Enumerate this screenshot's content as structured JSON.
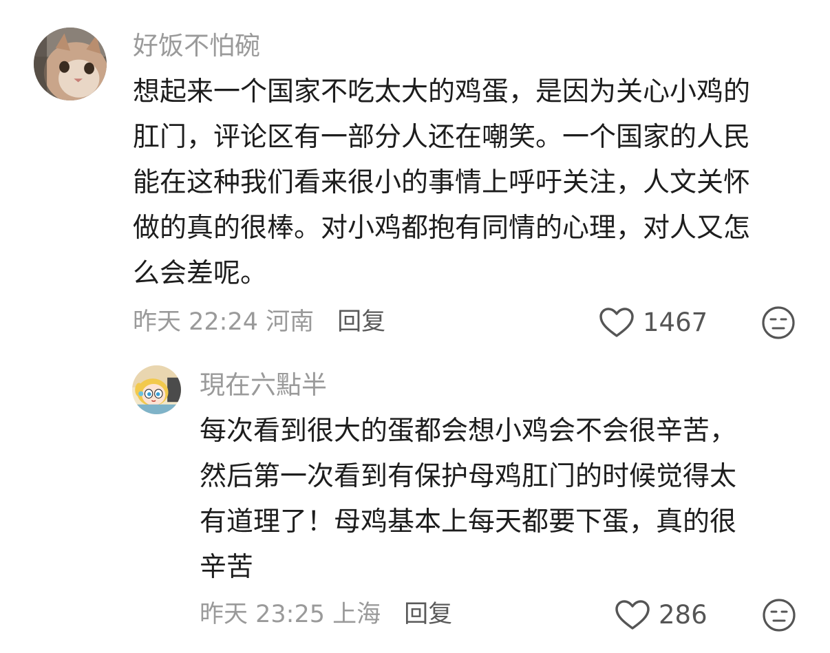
{
  "comments": [
    {
      "username": "好饭不怕碗",
      "avatar": "cat-avatar",
      "body_lines": [
        "想起来一个国家不吃太大的鸡蛋，是因为关心小鸡的",
        "肛门，评论区有一部分人还在嘲笑。一个国家的人民",
        "能在这种我们看来很小的事情上呼吁关注，人文关怀",
        "做的真的很棒。对小鸡都抱有同情的心理，对人又怎",
        "么会差呢。"
      ],
      "meta": "昨天 22:24 河南",
      "reply_label": "回复",
      "like_icon": "heart-outline-icon",
      "like_count": "1467",
      "dislike_icon": "unamused-face-icon",
      "replies": [
        {
          "username": "現在六點半",
          "avatar": "cartoon-girl-avatar",
          "body_lines": [
            "每次看到很大的蛋都会想小鸡会不会很辛苦，",
            "然后第一次看到有保护母鸡肛门的时候觉得太",
            "有道理了！母鸡基本上每天都要下蛋，真的很",
            "辛苦"
          ],
          "meta": "昨天 23:25 上海",
          "reply_label": "回复",
          "like_icon": "heart-outline-icon",
          "like_count": "286",
          "dislike_icon": "unamused-face-icon"
        }
      ]
    }
  ],
  "colors": {
    "secondary_text": "#9a9a9a",
    "primary_text": "#1d1d1d",
    "icon_stroke": "#555555"
  }
}
